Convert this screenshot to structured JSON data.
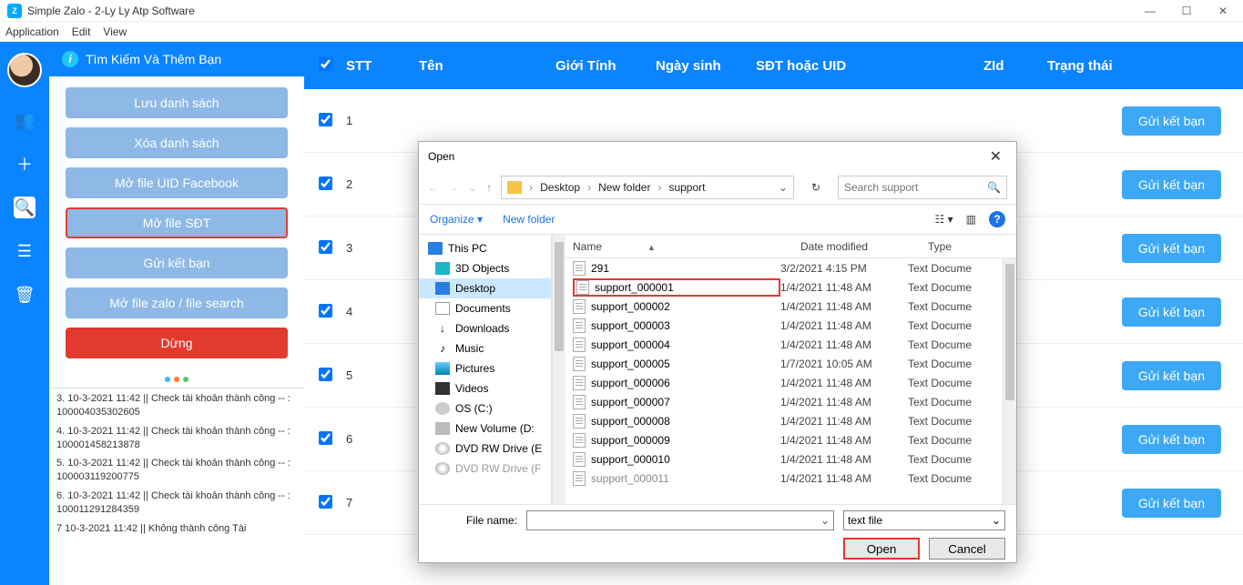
{
  "window": {
    "title": "Simple Zalo - 2-Ly Ly Atp Software"
  },
  "menubar": [
    "Application",
    "Edit",
    "View"
  ],
  "sidehead": {
    "title": "Tìm Kiếm Và Thêm Bạn"
  },
  "sidebar_buttons": {
    "b1": "Lưu danh sách",
    "b2": "Xóa danh sách",
    "b3": "Mở file UID Facebook",
    "b4": "Mở file SĐT",
    "b5": "Gửi kết bạn",
    "b6": "Mở file zalo / file search",
    "b7": "Dừng"
  },
  "log": [
    "3. 10-3-2021  11:42 || Check tài khoản thành công  -- : 100004035302605",
    "4. 10-3-2021  11:42 || Check tài khoản thành công  -- : 100001458213878",
    "5. 10-3-2021  11:42 || Check tài khoản thành công  -- : 100003119200775",
    "6. 10-3-2021  11:42 || Check tài khoản thành công  -- : 100011291284359",
    "7  10-3-2021  11:42 || Không thành công   Tài"
  ],
  "columns": {
    "chk": "",
    "stt": "STT",
    "ten": "Tên",
    "gt": "Giới Tính",
    "ns": "Ngày sinh",
    "sdt": "SĐT hoặc UID",
    "zid": "ZId",
    "tt": "Trạng thái"
  },
  "action_label": "Gửi kết bạn",
  "rows": [
    {
      "stt": "1"
    },
    {
      "stt": "2"
    },
    {
      "stt": "3"
    },
    {
      "stt": "4"
    },
    {
      "stt": "5"
    },
    {
      "stt": "6"
    },
    {
      "stt": "7"
    }
  ],
  "dialog": {
    "title": "Open",
    "crumbs": [
      "Desktop",
      "New folder",
      "support"
    ],
    "search_placeholder": "Search support",
    "organize": "Organize",
    "newfolder": "New folder",
    "tree": [
      {
        "label": "This PC",
        "cls": "ico-pc",
        "root": true
      },
      {
        "label": "3D Objects",
        "cls": "ico-3d"
      },
      {
        "label": "Desktop",
        "cls": "ico-desk",
        "sel": true
      },
      {
        "label": "Documents",
        "cls": "ico-doc"
      },
      {
        "label": "Downloads",
        "cls": "ico-dl",
        "glyph": "↓"
      },
      {
        "label": "Music",
        "cls": "ico-music",
        "glyph": "♪"
      },
      {
        "label": "Pictures",
        "cls": "ico-pic"
      },
      {
        "label": "Videos",
        "cls": "ico-vid"
      },
      {
        "label": "OS (C:)",
        "cls": "ico-os"
      },
      {
        "label": "New Volume (D:",
        "cls": "ico-vol"
      },
      {
        "label": "DVD RW Drive (E",
        "cls": "ico-dvd"
      },
      {
        "label": "DVD RW Drive (F",
        "cls": "ico-dvd",
        "dim": true
      }
    ],
    "headers": {
      "name": "Name",
      "dm": "Date modified",
      "ty": "Type"
    },
    "files": [
      {
        "name": "291",
        "dm": "3/2/2021 4:15 PM",
        "ty": "Text Docume"
      },
      {
        "name": "support_000001",
        "dm": "1/4/2021 11:48 AM",
        "ty": "Text Docume",
        "sel": true
      },
      {
        "name": "support_000002",
        "dm": "1/4/2021 11:48 AM",
        "ty": "Text Docume"
      },
      {
        "name": "support_000003",
        "dm": "1/4/2021 11:48 AM",
        "ty": "Text Docume"
      },
      {
        "name": "support_000004",
        "dm": "1/4/2021 11:48 AM",
        "ty": "Text Docume"
      },
      {
        "name": "support_000005",
        "dm": "1/7/2021 10:05 AM",
        "ty": "Text Docume"
      },
      {
        "name": "support_000006",
        "dm": "1/4/2021 11:48 AM",
        "ty": "Text Docume"
      },
      {
        "name": "support_000007",
        "dm": "1/4/2021 11:48 AM",
        "ty": "Text Docume"
      },
      {
        "name": "support_000008",
        "dm": "1/4/2021 11:48 AM",
        "ty": "Text Docume"
      },
      {
        "name": "support_000009",
        "dm": "1/4/2021 11:48 AM",
        "ty": "Text Docume"
      },
      {
        "name": "support_000010",
        "dm": "1/4/2021 11:48 AM",
        "ty": "Text Docume"
      },
      {
        "name": "support_000011",
        "dm": "1/4/2021 11:48 AM",
        "ty": "Text Docume",
        "dim": true
      }
    ],
    "filename_label": "File name:",
    "filename_value": "",
    "filetype": "text file",
    "open_btn": "Open",
    "cancel_btn": "Cancel"
  }
}
